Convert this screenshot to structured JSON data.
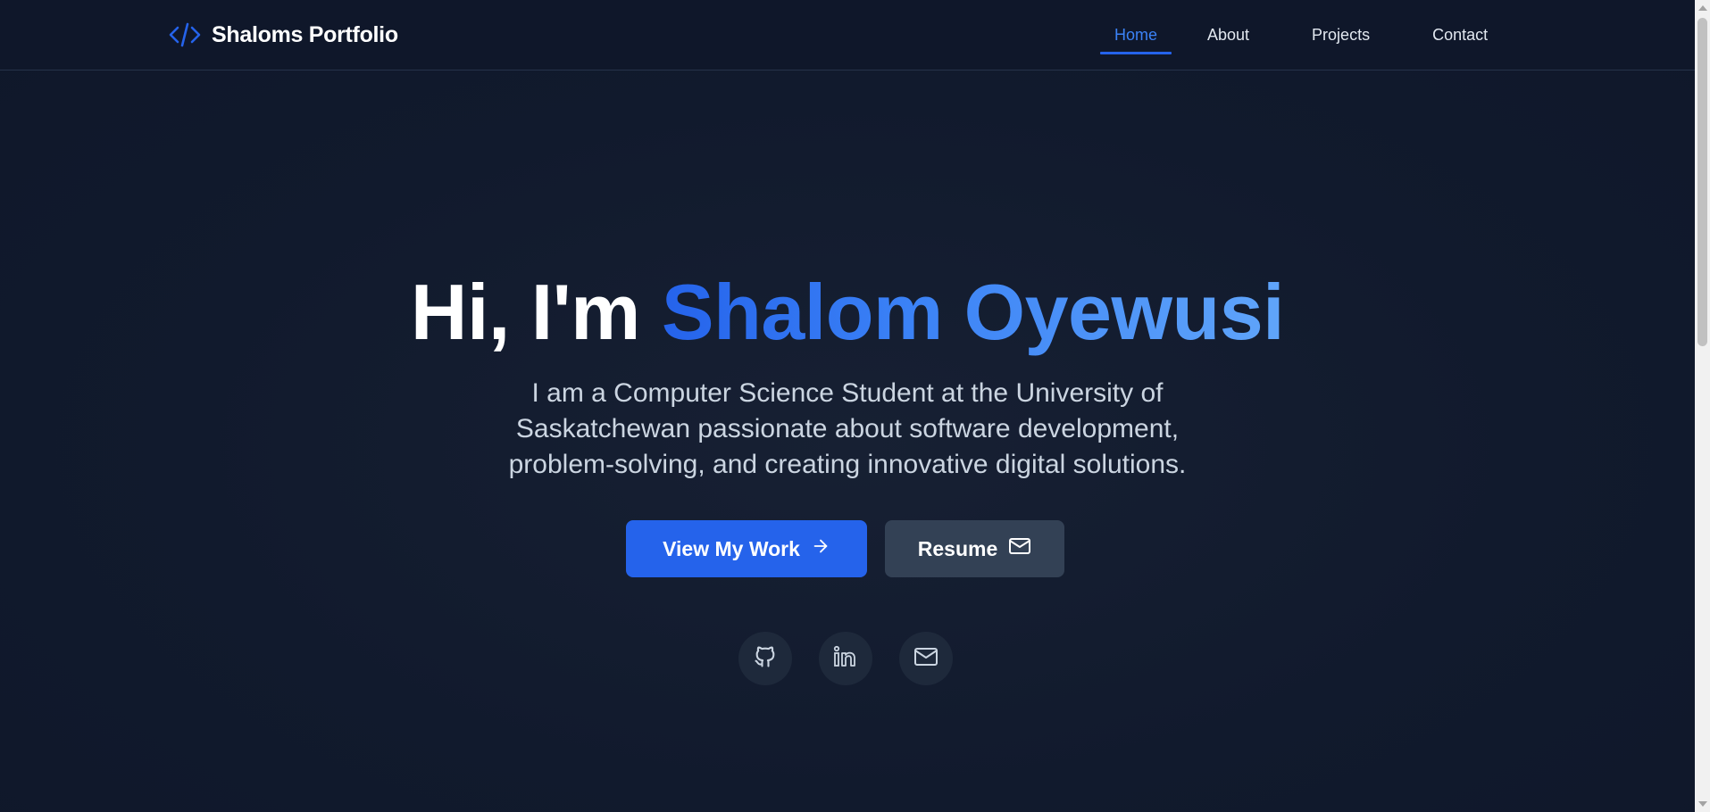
{
  "navbar": {
    "brand_icon": "code-brackets-icon",
    "brand_text": "Shaloms Portfolio",
    "links": [
      {
        "label": "Home",
        "active": true
      },
      {
        "label": "About",
        "active": false
      },
      {
        "label": "Projects",
        "active": false
      },
      {
        "label": "Contact",
        "active": false
      }
    ]
  },
  "hero": {
    "greeting": "Hi, I'm ",
    "name": "Shalom Oyewusi",
    "description_lines": [
      "I am a Computer Science Student at the University of",
      "Saskatchewan passionate about software development,",
      "problem-solving, and creating innovative digital solutions."
    ],
    "primary_button": {
      "label": "View My Work",
      "icon": "arrow-right-icon"
    },
    "secondary_button": {
      "label": "Resume",
      "icon": "mail-icon"
    },
    "socials": [
      {
        "icon": "github-icon"
      },
      {
        "icon": "linkedin-icon"
      },
      {
        "icon": "mail-icon"
      }
    ]
  },
  "colors": {
    "background": "#0f172a",
    "accent": "#2563eb",
    "accent_light": "#60a5fa",
    "secondary_button": "#334155",
    "social_bg": "#1e293b",
    "body_text": "#cbd5e1"
  }
}
